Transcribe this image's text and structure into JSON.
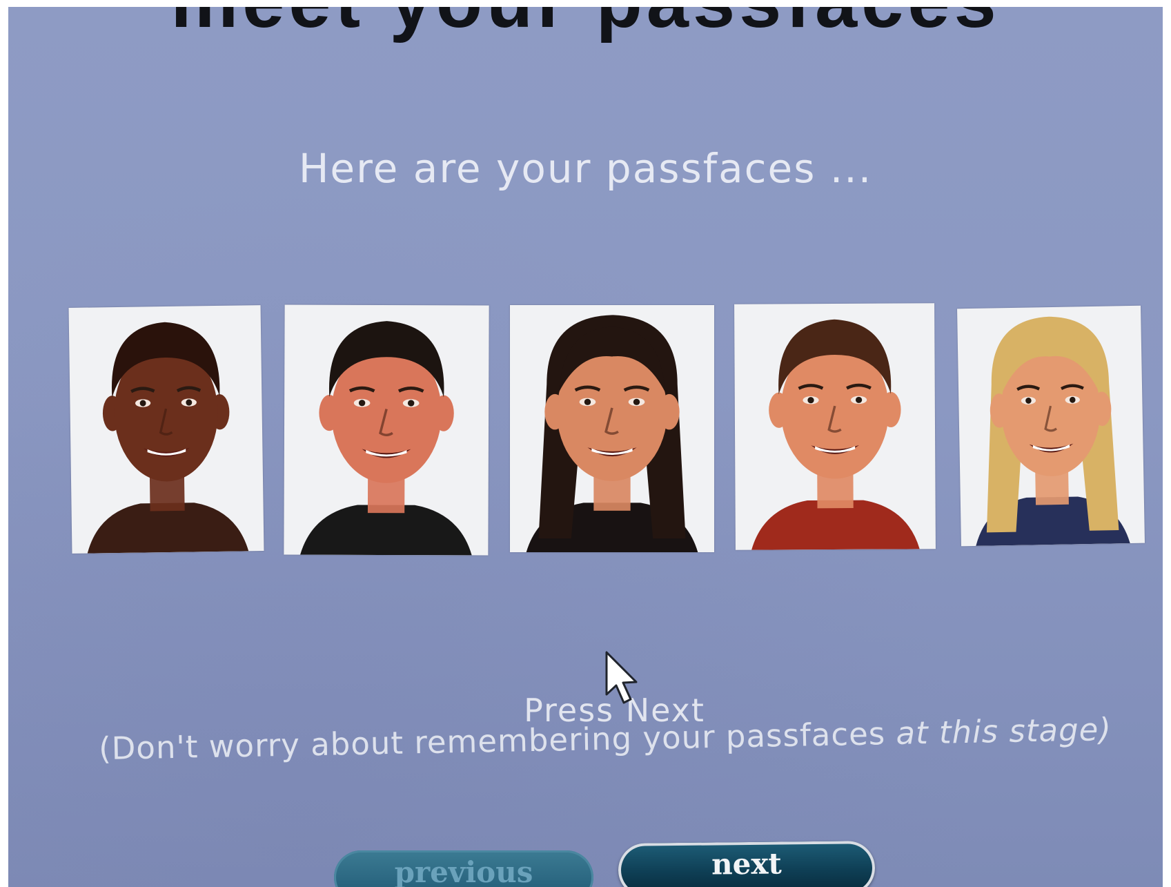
{
  "page": {
    "heading": "meet your passfaces",
    "subtitle": "Here are your passfaces ...",
    "instruction": "Press Next",
    "hint_start": "(Don't worry about remembering your passfaces ",
    "hint_end": "at this stage)"
  },
  "faces": [
    {
      "label": "passface-1",
      "hair": "#2a120b",
      "skin": "#6b2f1c",
      "shirt": "#3a1d14"
    },
    {
      "label": "passface-2",
      "hair": "#1c1410",
      "skin": "#d9765a",
      "shirt": "#181818"
    },
    {
      "label": "passface-3",
      "hair": "#231510",
      "skin": "#d98862",
      "shirt": "#181212"
    },
    {
      "label": "passface-4",
      "hair": "#4a2616",
      "skin": "#e08a64",
      "shirt": "#a02a1c"
    },
    {
      "label": "passface-5",
      "hair": "#d8b265",
      "skin": "#e49a70",
      "shirt": "#27305a"
    }
  ],
  "buttons": {
    "previous": "previous",
    "next": "next"
  },
  "colors": {
    "background": "#8b98c2",
    "text": "#e6e9f3",
    "heading": "#111318",
    "button_dark": "#0e3e54"
  }
}
